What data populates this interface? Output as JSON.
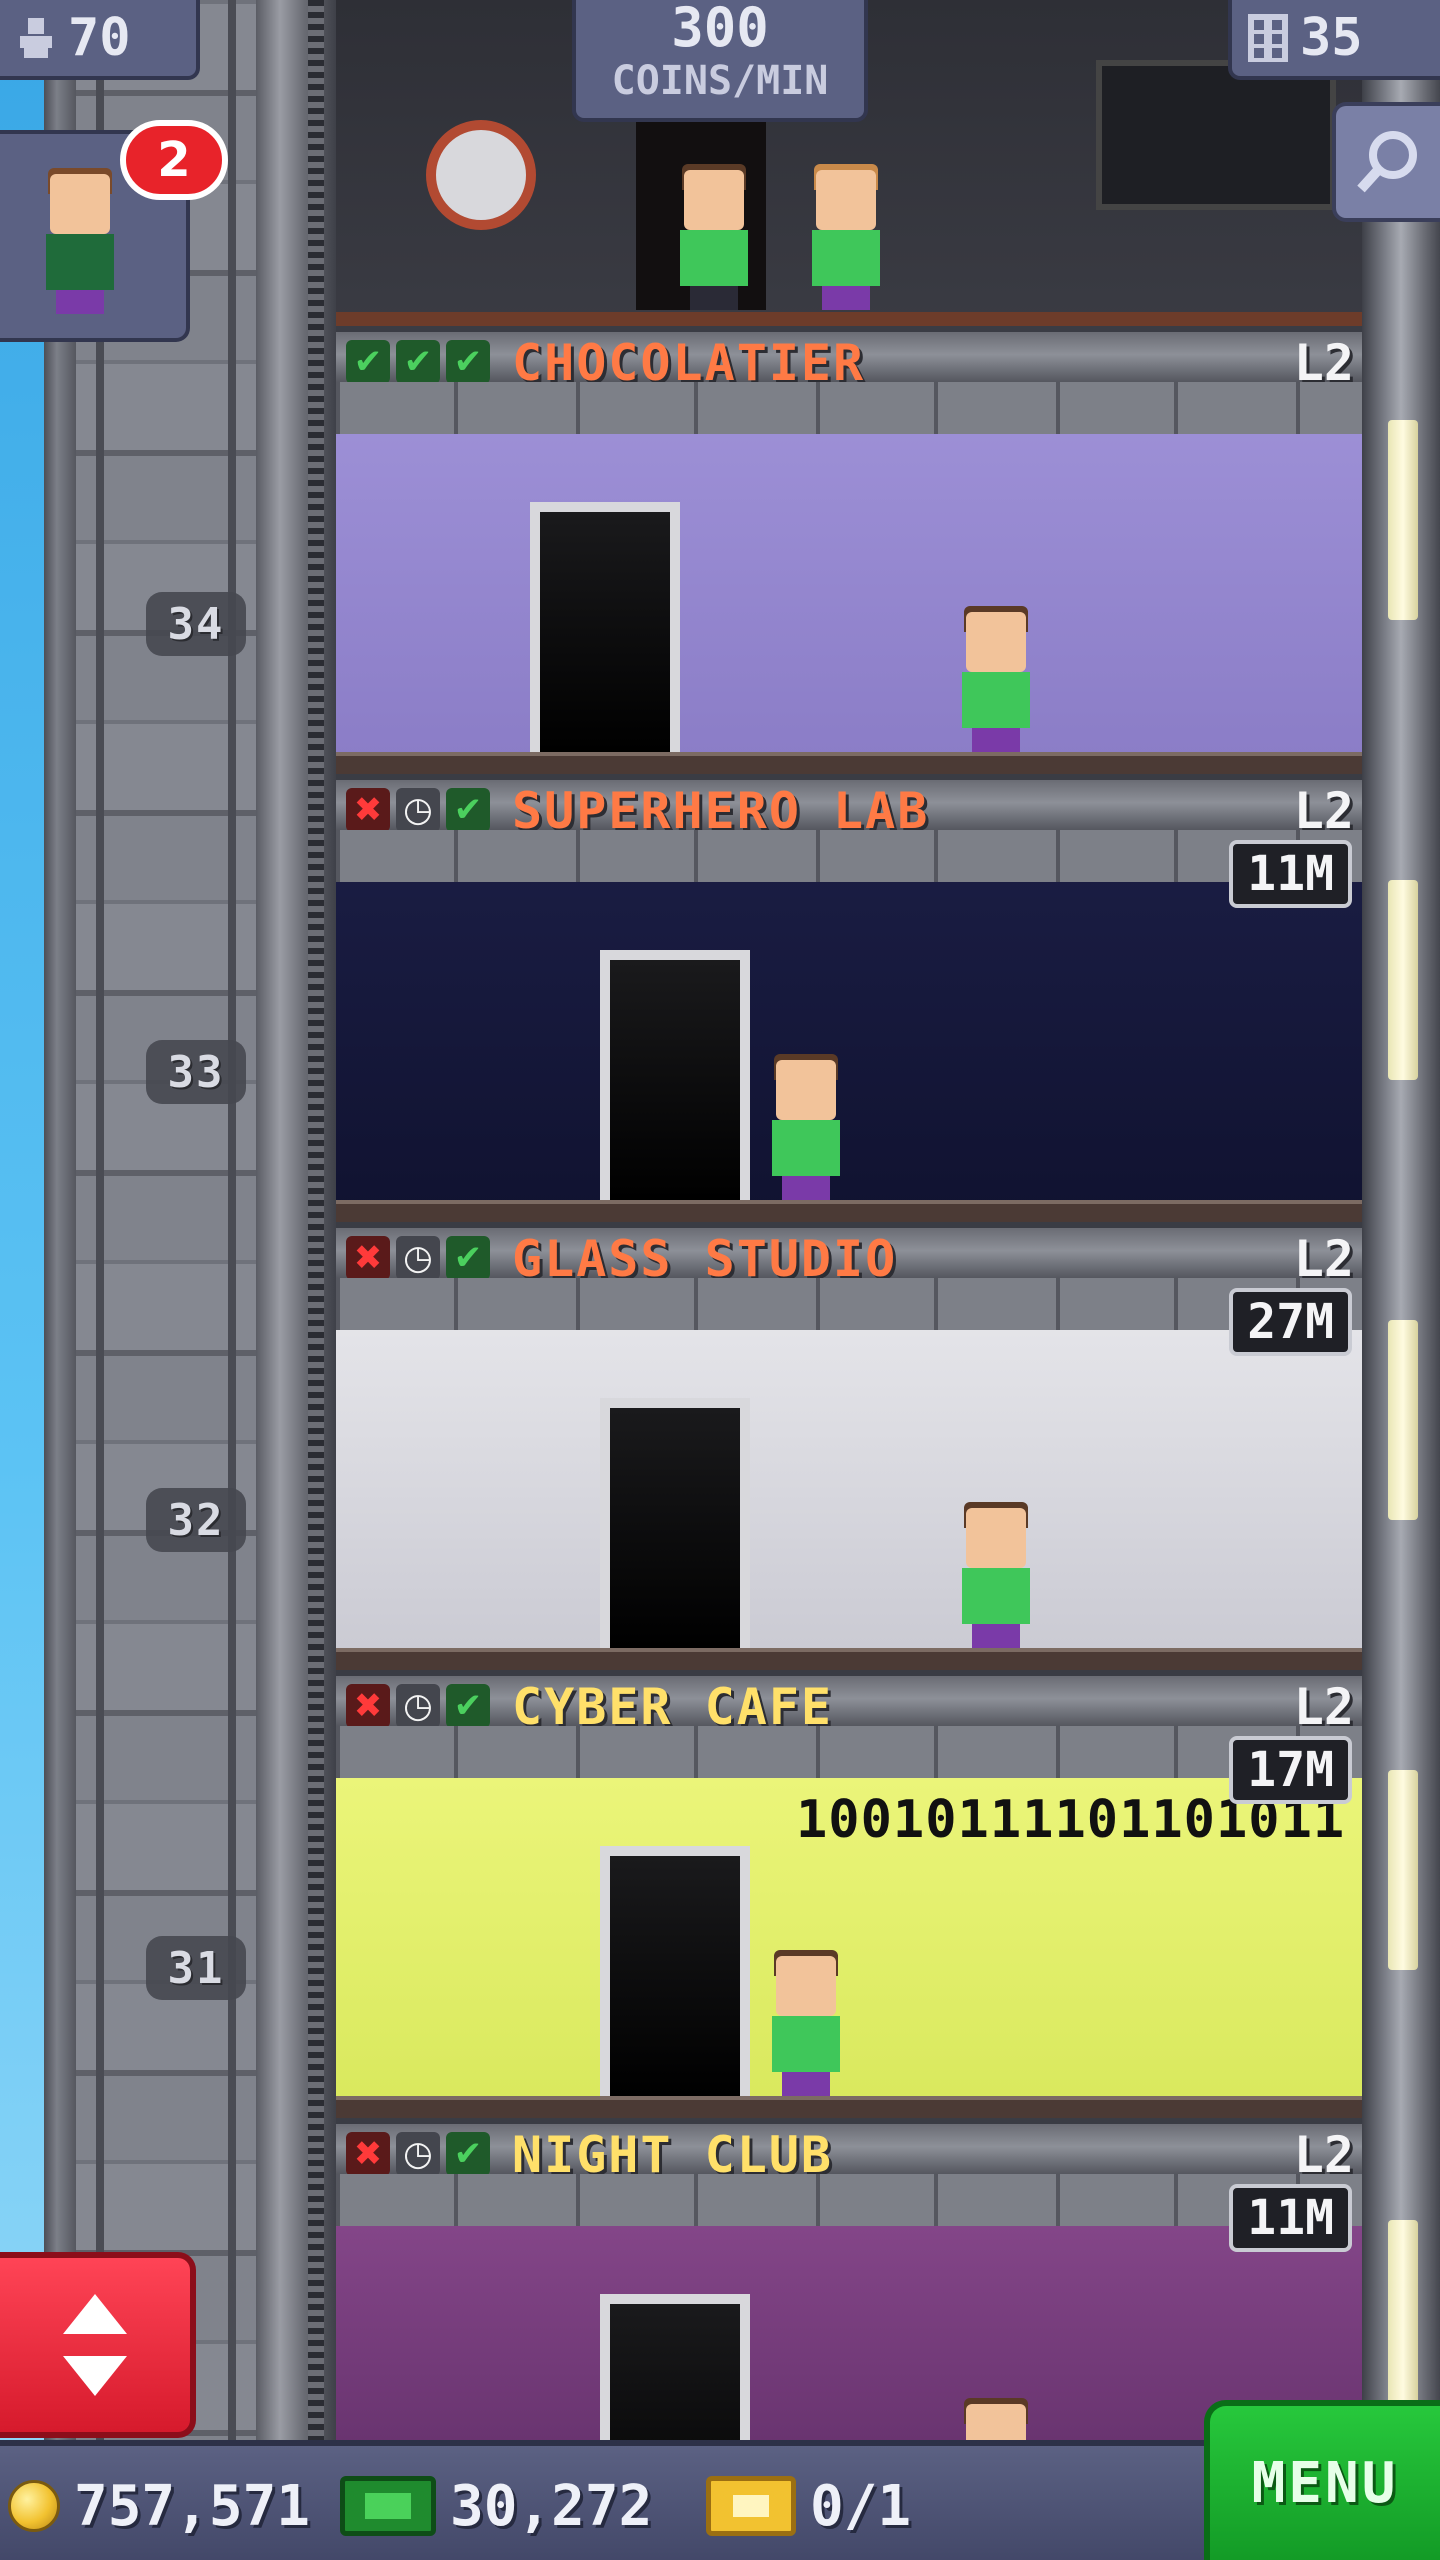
{
  "hud": {
    "population": "70",
    "coins_per_min_value": "300",
    "coins_per_min_label": "COINS/MIN",
    "floor_count": "35",
    "visitor_badge": "2"
  },
  "shaft": {
    "floor_numbers": [
      "34",
      "33",
      "32",
      "31"
    ]
  },
  "floors": [
    {
      "name": "CHOCOLATIER",
      "level": "L2",
      "stock": "",
      "name_color": "#ff7a45",
      "status": [
        "check",
        "check",
        "check"
      ]
    },
    {
      "name": "SUPERHERO LAB",
      "level": "L2",
      "stock": "11M",
      "name_color": "#ff7a45",
      "status": [
        "cross",
        "clock",
        "check"
      ]
    },
    {
      "name": "GLASS STUDIO",
      "level": "L2",
      "stock": "27M",
      "name_color": "#ff7a45",
      "status": [
        "cross",
        "clock",
        "check"
      ]
    },
    {
      "name": "CYBER CAFE",
      "level": "L2",
      "stock": "17M",
      "name_color": "#ffe06a",
      "status": [
        "cross",
        "clock",
        "check"
      ]
    },
    {
      "name": "NIGHT CLUB",
      "level": "L2",
      "stock": "11M",
      "name_color": "#ffe06a",
      "status": [
        "cross",
        "clock",
        "check"
      ]
    }
  ],
  "decor": {
    "binary_text": "10010111101101011"
  },
  "bottom_bar": {
    "coins": "757,571",
    "bux": "30,272",
    "tickets": "0/1",
    "menu_label": "MENU"
  },
  "icons": {
    "population": "person-icon",
    "floors": "building-icon",
    "zoom": "magnifier-icon",
    "elevator": "up-down-arrows-icon",
    "coin": "coin-icon",
    "bux": "bux-icon",
    "ticket": "golden-ticket-icon",
    "status": {
      "check": "check-icon",
      "cross": "cross-icon",
      "clock": "clock-icon"
    }
  },
  "colors": {
    "hud_panel": "#5b6183",
    "menu_green": "#1fb431",
    "elevator_red": "#e8283a",
    "badge_red": "#e8232a"
  }
}
